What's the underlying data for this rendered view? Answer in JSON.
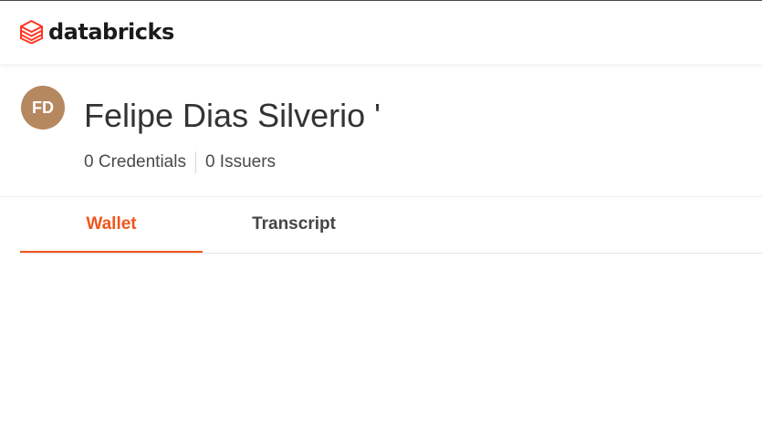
{
  "header": {
    "logo_text": "databricks",
    "logo_icon": "databricks-layers-icon",
    "brand_color": "#ff3621"
  },
  "profile": {
    "initials": "FD",
    "name": "Felipe Dias Silverio '",
    "credentials": "0 Credentials",
    "issuers": "0 Issuers",
    "avatar_color": "#b68860"
  },
  "tabs": [
    {
      "label": "Wallet",
      "active": true
    },
    {
      "label": "Transcript",
      "active": false
    }
  ],
  "colors": {
    "accent": "#f0561d",
    "text": "#333333"
  }
}
